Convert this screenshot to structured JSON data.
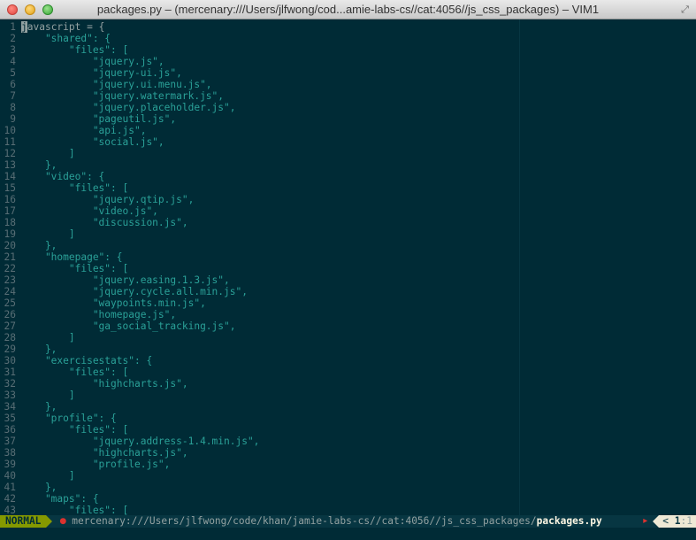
{
  "window": {
    "title": "packages.py – (mercenary:///Users/jlfwong/cod...amie-labs-cs//cat:4056//js_css_packages) – VIM1"
  },
  "lines": [
    {
      "n": "1",
      "pre": "",
      "cursor": "j",
      "text": "avascript = {"
    },
    {
      "n": "2",
      "text": "    \"shared\": {"
    },
    {
      "n": "3",
      "text": "        \"files\": ["
    },
    {
      "n": "4",
      "text": "            \"jquery.js\","
    },
    {
      "n": "5",
      "text": "            \"jquery-ui.js\","
    },
    {
      "n": "6",
      "text": "            \"jquery.ui.menu.js\","
    },
    {
      "n": "7",
      "text": "            \"jquery.watermark.js\","
    },
    {
      "n": "8",
      "text": "            \"jquery.placeholder.js\","
    },
    {
      "n": "9",
      "text": "            \"pageutil.js\","
    },
    {
      "n": "10",
      "text": "            \"api.js\","
    },
    {
      "n": "11",
      "text": "            \"social.js\","
    },
    {
      "n": "12",
      "text": "        ]"
    },
    {
      "n": "13",
      "text": "    },"
    },
    {
      "n": "14",
      "text": "    \"video\": {"
    },
    {
      "n": "15",
      "text": "        \"files\": ["
    },
    {
      "n": "16",
      "text": "            \"jquery.qtip.js\","
    },
    {
      "n": "17",
      "text": "            \"video.js\","
    },
    {
      "n": "18",
      "text": "            \"discussion.js\","
    },
    {
      "n": "19",
      "text": "        ]"
    },
    {
      "n": "20",
      "text": "    },"
    },
    {
      "n": "21",
      "text": "    \"homepage\": {"
    },
    {
      "n": "22",
      "text": "        \"files\": ["
    },
    {
      "n": "23",
      "text": "            \"jquery.easing.1.3.js\","
    },
    {
      "n": "24",
      "text": "            \"jquery.cycle.all.min.js\","
    },
    {
      "n": "25",
      "text": "            \"waypoints.min.js\","
    },
    {
      "n": "26",
      "text": "            \"homepage.js\","
    },
    {
      "n": "27",
      "text": "            \"ga_social_tracking.js\","
    },
    {
      "n": "28",
      "text": "        ]"
    },
    {
      "n": "29",
      "text": "    },"
    },
    {
      "n": "30",
      "text": "    \"exercisestats\": {"
    },
    {
      "n": "31",
      "text": "        \"files\": ["
    },
    {
      "n": "32",
      "text": "            \"highcharts.js\","
    },
    {
      "n": "33",
      "text": "        ]"
    },
    {
      "n": "34",
      "text": "    },"
    },
    {
      "n": "35",
      "text": "    \"profile\": {"
    },
    {
      "n": "36",
      "text": "        \"files\": ["
    },
    {
      "n": "37",
      "text": "            \"jquery.address-1.4.min.js\","
    },
    {
      "n": "38",
      "text": "            \"highcharts.js\","
    },
    {
      "n": "39",
      "text": "            \"profile.js\","
    },
    {
      "n": "40",
      "text": "        ]"
    },
    {
      "n": "41",
      "text": "    },"
    },
    {
      "n": "42",
      "text": "    \"maps\": {"
    },
    {
      "n": "43",
      "text": "        \"files\": ["
    }
  ],
  "statusline": {
    "mode": "NORMAL",
    "lock_icon": "lock-icon",
    "path": "mercenary:///Users/jlfwong/code/khan/jamie-labs-cs//cat:4056//js_css_packages/",
    "filename": "packages.py",
    "modified_icon": "modified-icon",
    "pos_prefix": "< ",
    "line": "1",
    "col": ":1"
  },
  "colors": {
    "background": "#002b36",
    "string": "#2aa198",
    "line_number": "#586e75",
    "mode_bg": "#859900"
  }
}
